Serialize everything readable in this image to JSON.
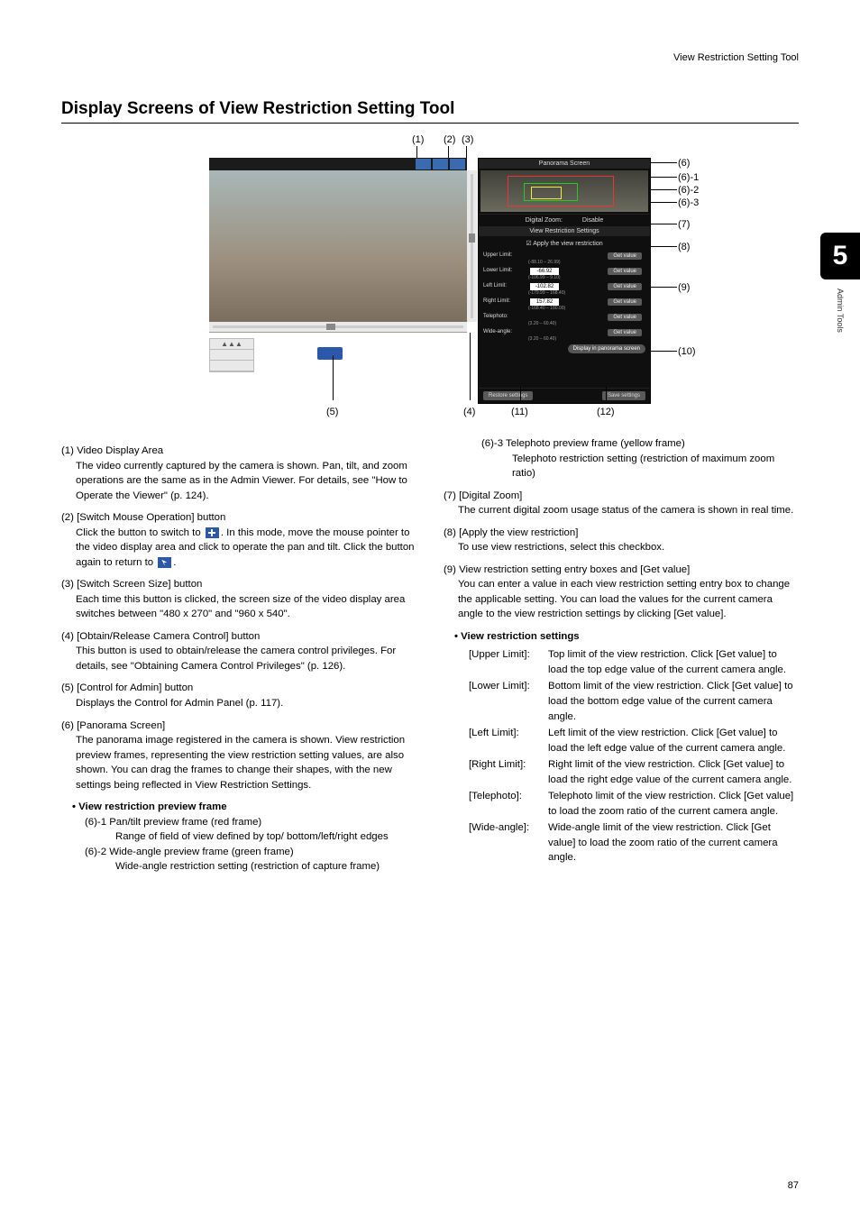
{
  "top_right": "View Restriction Setting Tool",
  "chapter": {
    "number": "5",
    "label": "Admin Tools"
  },
  "section_title": "Display Screens of View Restriction Setting Tool",
  "figure": {
    "callouts_top": {
      "c1": "(1)",
      "c2": "(2)",
      "c3": "(3)"
    },
    "callouts_bottom": {
      "c5": "(5)",
      "c4": "(4)",
      "c11": "(11)",
      "c12": "(12)"
    },
    "callouts_right": {
      "c6": "(6)",
      "c6_1": "(6)-1",
      "c6_2": "(6)-2",
      "c6_3": "(6)-3",
      "c7": "(7)",
      "c8": "(8)",
      "c9": "(9)",
      "c10": "(10)"
    },
    "panel": {
      "head_panorama": "Panorama Screen",
      "digital_zoom_label": "Digital Zoom:",
      "digital_zoom_value": "Disable",
      "head_vrs": "View Restriction Settings",
      "apply_label": "Apply the view restriction",
      "fields": [
        {
          "label": "Upper Limit:",
          "value": "",
          "range": "(-88.10 – 26.99)"
        },
        {
          "label": "Lower Limit:",
          "value": "-66.92",
          "range": "(-106.99 – 9.10)"
        },
        {
          "label": "Left Limit:",
          "value": "-102.82",
          "range": "(-179.99 – 168.40)"
        },
        {
          "label": "Right Limit:",
          "value": "157.82",
          "range": "(-168.40 – 180.00)"
        },
        {
          "label": "Telephoto:",
          "value": "",
          "range": "(3.20 – 60.40)"
        },
        {
          "label": "Wide-angle:",
          "value": "",
          "range": "(3.20 – 60.40)"
        }
      ],
      "get_value": "Get value",
      "display_panorama": "Display in panorama screen",
      "restore": "Restore settings",
      "save": "Save settings"
    }
  },
  "left_items": {
    "i1": {
      "head": "(1)  Video Display Area",
      "body": "The video currently captured by the camera is shown. Pan, tilt, and zoom operations are the same as in the Admin Viewer. For details, see \"How to Operate the Viewer\" (p. 124)."
    },
    "i2": {
      "head": "(2)  [Switch Mouse Operation] button",
      "body1": "Click the button to switch to ",
      "body2": ". In this mode, move the mouse pointer to the video display area and click to operate the pan and tilt. Click the button again to return to ",
      "body3": "."
    },
    "i3": {
      "head": "(3)  [Switch Screen Size] button",
      "body": "Each time this button is clicked, the screen size of the video display area switches between \"480 x 270\" and \"960 x 540\"."
    },
    "i4": {
      "head": "(4)  [Obtain/Release Camera Control] button",
      "body": "This button is used to obtain/release the camera control privileges. For details, see \"Obtaining Camera Control Privileges\" (p. 126)."
    },
    "i5": {
      "head": "(5)  [Control for Admin] button",
      "body": "Displays the Control for Admin Panel (p. 117)."
    },
    "i6": {
      "head": "(6)  [Panorama Screen]",
      "body": "The panorama image registered in the camera is shown. View restriction preview frames, representing the view restriction setting values, are also shown. You can drag the frames to change their shapes, with the new settings being reflected in View Restriction Settings.",
      "bullet": "View restriction preview frame",
      "sub1_head": "(6)-1 Pan/tilt preview frame (red frame)",
      "sub1_body": "Range of field of view defined by top/ bottom/left/right edges",
      "sub2_head": "(6)-2 Wide-angle preview frame (green frame)",
      "sub2_body": "Wide-angle restriction setting (restriction of capture frame)"
    }
  },
  "right_items": {
    "i6_3": {
      "head": "(6)-3 Telephoto preview frame (yellow frame)",
      "body": "Telephoto restriction setting (restriction of maximum zoom ratio)"
    },
    "i7": {
      "head": "(7)  [Digital Zoom]",
      "body": "The current digital zoom usage status of the camera is shown in real time."
    },
    "i8": {
      "head": "(8)  [Apply the view restriction]",
      "body": "To use view restrictions, select this checkbox."
    },
    "i9": {
      "head": "(9)  View restriction setting entry boxes and [Get value]",
      "body": "You can enter a value in each view restriction setting entry box to change the applicable setting. You can load the values for the current camera angle to the view restriction settings by clicking [Get value].",
      "bullet": "View restriction settings",
      "table": [
        {
          "label": "[Upper Limit]:",
          "desc": "Top limit of the view restriction. Click [Get value] to load the top edge value of the current camera angle."
        },
        {
          "label": "[Lower Limit]:",
          "desc": "Bottom limit of the view restriction. Click [Get value] to load the bottom edge value of the current camera angle."
        },
        {
          "label": "[Left Limit]:",
          "desc": "Left limit of the view restriction. Click [Get value] to load the left edge value of the current camera angle."
        },
        {
          "label": "[Right Limit]:",
          "desc": "Right limit of the view restriction. Click [Get value] to load the right edge value of the current camera angle."
        },
        {
          "label": "[Telephoto]:",
          "desc": "Telephoto limit of the view restriction. Click [Get value] to load the zoom ratio of the current camera angle."
        },
        {
          "label": "[Wide-angle]:",
          "desc": "Wide-angle limit of the view restriction. Click [Get value] to load the zoom ratio of the current camera angle."
        }
      ]
    }
  },
  "page_number": "87"
}
